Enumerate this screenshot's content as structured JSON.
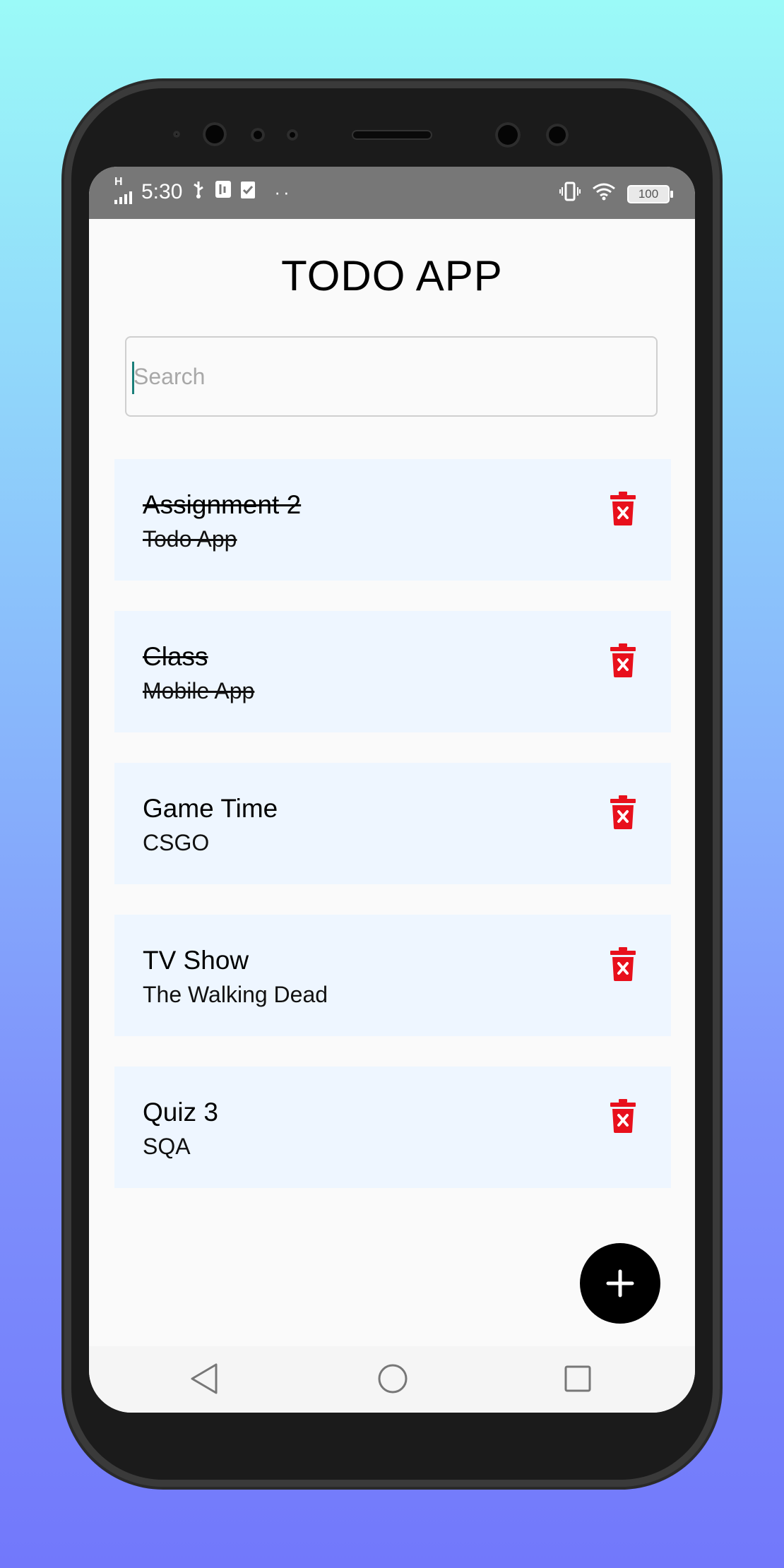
{
  "status_bar": {
    "signal": "H",
    "time": "5:30",
    "battery": "100"
  },
  "app": {
    "title": "TODO APP"
  },
  "search": {
    "placeholder": "Search",
    "value": ""
  },
  "todos": [
    {
      "title": "Assignment 2",
      "description": "Todo App",
      "completed": true
    },
    {
      "title": "Class",
      "description": "Mobile App",
      "completed": true
    },
    {
      "title": "Game Time",
      "description": "CSGO",
      "completed": false
    },
    {
      "title": "TV Show",
      "description": "The Walking Dead",
      "completed": false
    },
    {
      "title": "Quiz 3",
      "description": "SQA",
      "completed": false
    }
  ],
  "icons": {
    "delete": "trash-icon",
    "add": "plus-icon",
    "nav_back": "back-triangle-icon",
    "nav_home": "home-circle-icon",
    "nav_recents": "recents-square-icon"
  },
  "colors": {
    "status_bar": "#777777",
    "card_background": "#eef6ff",
    "delete_icon": "#e8101c",
    "fab": "#000000",
    "cursor": "#1a7f7a"
  }
}
